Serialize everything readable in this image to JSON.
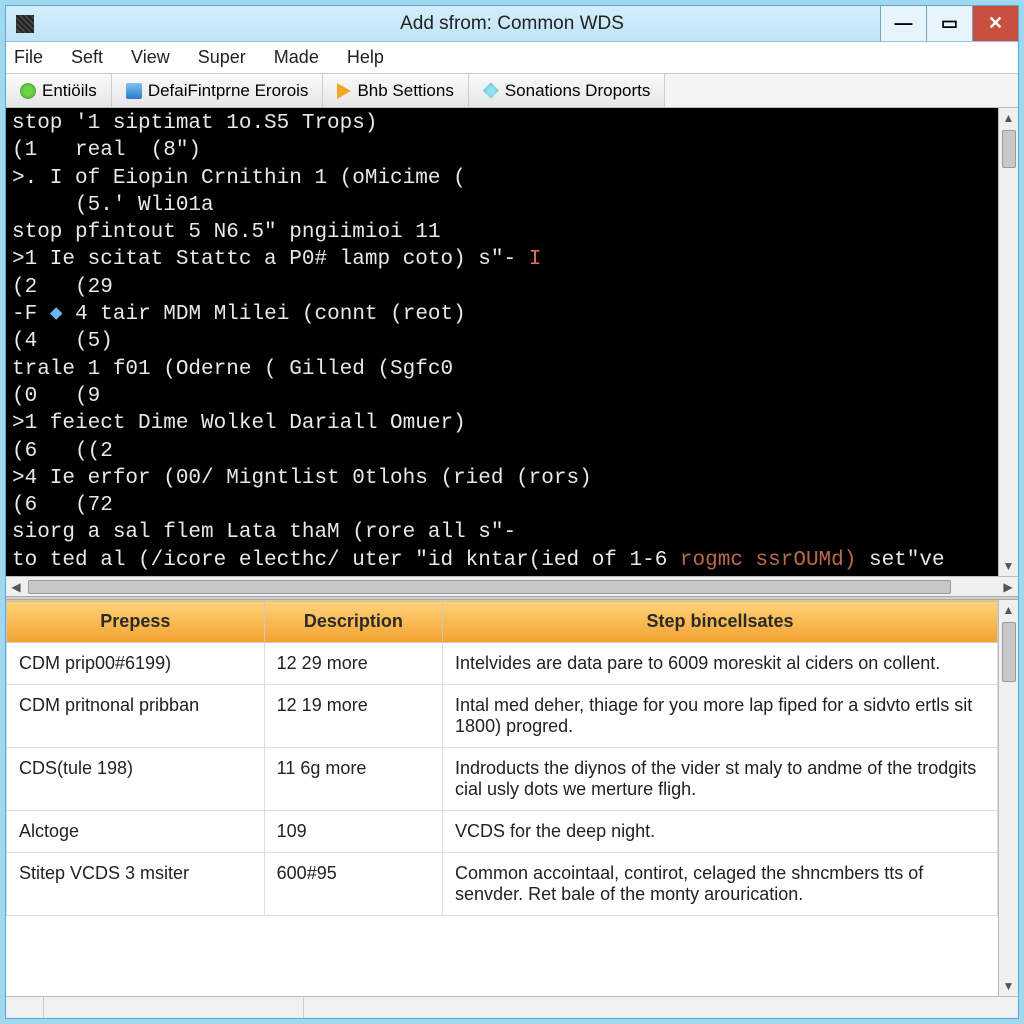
{
  "window": {
    "title": "Add sfrom: Common WDS"
  },
  "menu": {
    "file": "File",
    "seft": "Seft",
    "view": "View",
    "super": "Super",
    "made": "Made",
    "help": "Help"
  },
  "tabs": [
    {
      "label": "Entiöils"
    },
    {
      "label": "DefaiFintprne Erorois"
    },
    {
      "label": "Bhb Settions"
    },
    {
      "label": "Sonations Droports"
    }
  ],
  "console": {
    "l0": "stop '1 siptimat 1o.S5 Trops)",
    "l1": "(1   real  (8\")",
    "l2": ">. I of Eiopin Crnithin 1 (oMicime (",
    "l3": "     (5.' Wli01a",
    "l4": "stop pfintout 5 N6.5\" pngiimioi 11",
    "l5a": ">1 Ie scitat Stattc a P0# lamp coto) s\"- ",
    "l5b": "I",
    "l6": "(2   (29",
    "l7a": "-F ",
    "l7b": " 4 tair MDM Mlilei (connt (reot)",
    "l8": "(4   (5)",
    "l9": "trale 1 f01 (Oderne ( Gilled (Sgfc0",
    "l10": "(0   (9",
    "l11": ">1 feiect Dime Wolkel Dariall Omuer)",
    "l12": "(6   ((2",
    "l13": ">4 Ie erfor (00/ Migntlist 0tlohs (ried (rors)",
    "l14": "(6   (72",
    "l15": "siorg a sal flem Lata thaM (rore all s\"-",
    "l16a": "to ted al (/icore electhc/ uter \"id kntar(ied of 1-6 ",
    "l16b": "rogmc ssrOUMd)",
    "l16c": " set\"ve"
  },
  "table": {
    "headers": {
      "c1": "Prepess",
      "c2": "Description",
      "c3": "Step bincellsates"
    },
    "rows": [
      {
        "c1": "CDM prip00#6199)",
        "c2": "12 29 more",
        "c3": "Intelvides are data pare to 6009 moreskit al ciders on collent."
      },
      {
        "c1": "CDM pritnonal pribban",
        "c2": "12 19 more",
        "c3": "Intal med deher, thiage for you more lap fiped for a sidvto ertls sit 1800) progred."
      },
      {
        "c1": "CDS(tule 198)",
        "c2": "11 6g more",
        "c3": "Indroducts the diynos of the vider st maly to andme of the trodgits cial usly dots we merture fligh."
      },
      {
        "c1": "Alctoge",
        "c2": "109",
        "c3": "VCDS for the deep night."
      },
      {
        "c1": "Stitep VCDS 3 msiter",
        "c2": "600#95",
        "c3": "Common accointaal, contirot, celaged the shncmbers tts of senvder. Ret bale of the monty arourication."
      }
    ]
  }
}
